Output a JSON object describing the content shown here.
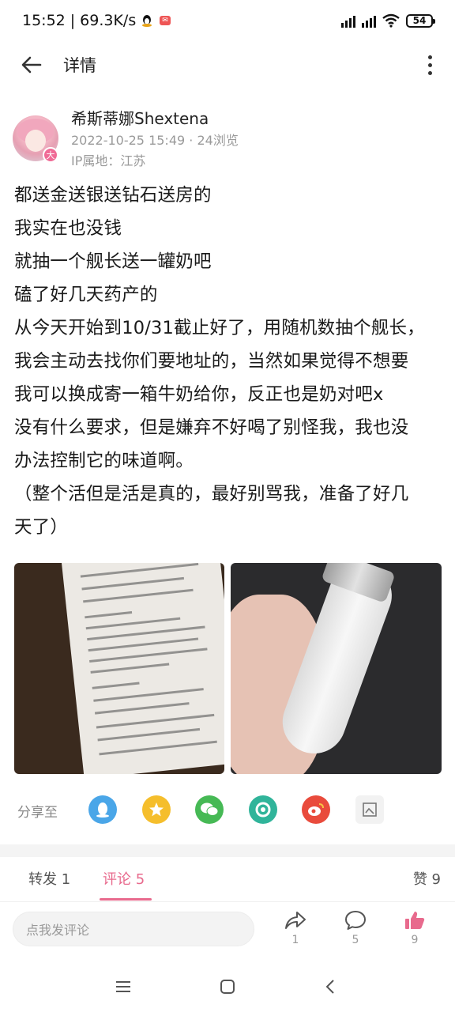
{
  "status_bar": {
    "time": "15:52",
    "network_speed": "69.3K/s",
    "battery": "54"
  },
  "header": {
    "title": "详情"
  },
  "author": {
    "name": "希斯蒂娜Shextena",
    "date": "2022-10-25 15:49",
    "views": "24浏览",
    "ip_location": "IP属地：江苏",
    "badge": "大"
  },
  "post": {
    "lines": [
      "都送金送银送钻石送房的",
      "我实在也没钱",
      "就抽一个舰长送一罐奶吧",
      "磕了好几天药产的",
      "从今天开始到10/31截止好了，用随机数抽个舰长，",
      "我会主动去找你们要地址的，当然如果觉得不想要",
      "我可以换成寄一箱牛奶给你，反正也是奶对吧x",
      "没有什么要求，但是嫌弃不好喝了别怪我，我也没",
      "办法控制它的味道啊。",
      "（整个活但是活是真的，最好别骂我，准备了好几",
      "天了）"
    ]
  },
  "share": {
    "label": "分享至",
    "targets": [
      "qq-icon",
      "qzone-icon",
      "wechat-icon",
      "moments-icon",
      "weibo-icon",
      "more-share-icon"
    ]
  },
  "tabs": {
    "repost": "转发 1",
    "comments": "评论 5",
    "likes": "赞 9"
  },
  "bottom_bar": {
    "comment_placeholder": "点我发评论",
    "share_count": "1",
    "comment_count": "5",
    "like_count": "9"
  },
  "colors": {
    "accent": "#e86a8d",
    "muted": "#9a9a9a"
  }
}
